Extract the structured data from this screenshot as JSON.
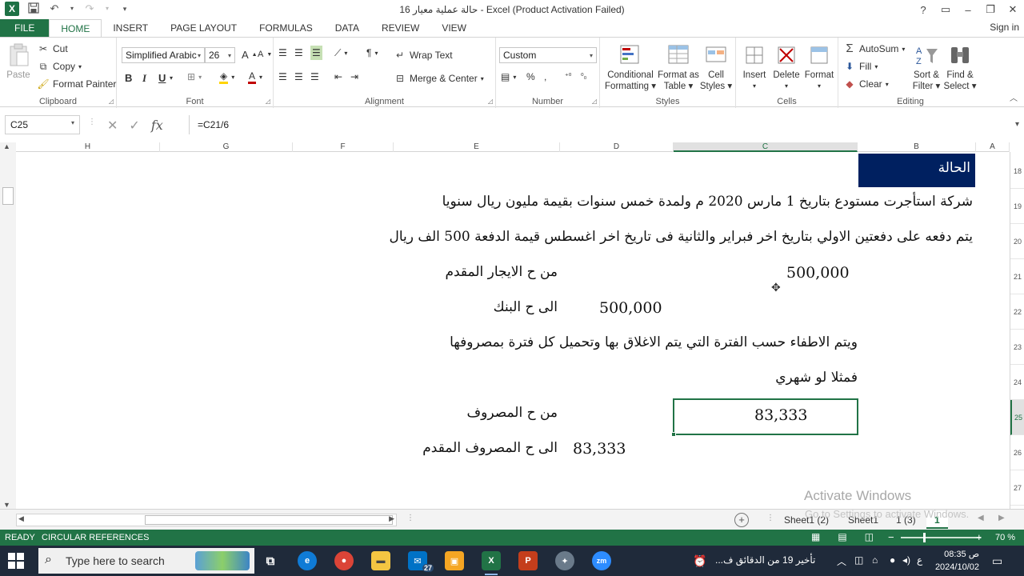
{
  "window": {
    "title": "حالة عملية معيار 16 - Excel (Product Activation Failed)",
    "controls": [
      "?",
      "▭",
      "–",
      "❐",
      "✕"
    ]
  },
  "ribbon": {
    "tabs": [
      "FILE",
      "HOME",
      "INSERT",
      "PAGE LAYOUT",
      "FORMULAS",
      "DATA",
      "REVIEW",
      "VIEW"
    ],
    "active_tab": "HOME",
    "signin": "Sign in",
    "clipboard": {
      "paste": "Paste",
      "cut": "Cut",
      "copy": "Copy",
      "format_painter": "Format Painter",
      "label": "Clipboard"
    },
    "font": {
      "name": "Simplified Arabic",
      "size": "26",
      "bold": "B",
      "italic": "I",
      "underline": "U",
      "label": "Font"
    },
    "alignment": {
      "wrap": "Wrap Text",
      "merge": "Merge & Center",
      "label": "Alignment"
    },
    "number": {
      "format": "Custom",
      "label": "Number"
    },
    "styles": {
      "conditional": [
        "Conditional",
        "Formatting"
      ],
      "format_as": [
        "Format as",
        "Table"
      ],
      "cell_styles": [
        "Cell",
        "Styles"
      ],
      "label": "Styles"
    },
    "cells": {
      "insert": "Insert",
      "delete": "Delete",
      "format": "Format",
      "label": "Cells"
    },
    "editing": {
      "autosum": "AutoSum",
      "fill": "Fill",
      "clear": "Clear",
      "sort": [
        "Sort &",
        "Filter"
      ],
      "find": [
        "Find &",
        "Select"
      ],
      "label": "Editing"
    }
  },
  "formula_bar": {
    "name_box": "C25",
    "fx": "fx",
    "formula": "=C21/6"
  },
  "columns": [
    "H",
    "G",
    "F",
    "E",
    "D",
    "C",
    "B",
    "A"
  ],
  "rows": [
    "18",
    "19",
    "20",
    "21",
    "22",
    "23",
    "24",
    "25",
    "26",
    "27"
  ],
  "sheet": {
    "header": "الحالة",
    "line1": "شركة استأجرت مستودع بتاريخ 1 مارس 2020 م ولمدة خمس سنوات بقيمة مليون ريال سنويا",
    "line2": "يتم دفعه على دفعتين الاولي بتاريخ اخر فبراير والثانية فى تاريخ اخر اغسطس  قيمة الدفعة 500 الف ريال",
    "r21_value": "500,000",
    "r21_text": "من ح الايجار المقدم",
    "r22_value": "500,000",
    "r22_text": "الى ح البنك",
    "line23": "ويتم الاطفاء حسب الفترة التي يتم الاغلاق بها وتحميل كل فترة بمصروفها",
    "line24": "فمثلا لو شهري",
    "r25_value": "83,333",
    "r25_text": "من ح المصروف",
    "r26_value": "83,333",
    "r26_text": "الى ح المصروف المقدم"
  },
  "watermark": {
    "line1": "Activate Windows",
    "line2": "Go to Settings to activate Windows."
  },
  "sheet_tabs": [
    "Sheet1 (2)",
    "Sheet1",
    "1 (3)",
    "1"
  ],
  "active_sheet": "1",
  "status": {
    "ready": "READY",
    "circular": "CIRCULAR REFERENCES",
    "zoom": "70 %",
    "zoom_level": 0.28
  },
  "taskbar": {
    "search_placeholder": "Type here to search",
    "mail_badge": "27",
    "notification": "تأخير 19 من الدقائق ف...",
    "lang": "ع",
    "time": "08:35 ص",
    "date": "2024/10/02"
  },
  "colors": {
    "excel_green": "#217346",
    "header_fill": "#002060",
    "taskbar": "#1f2a3a"
  }
}
